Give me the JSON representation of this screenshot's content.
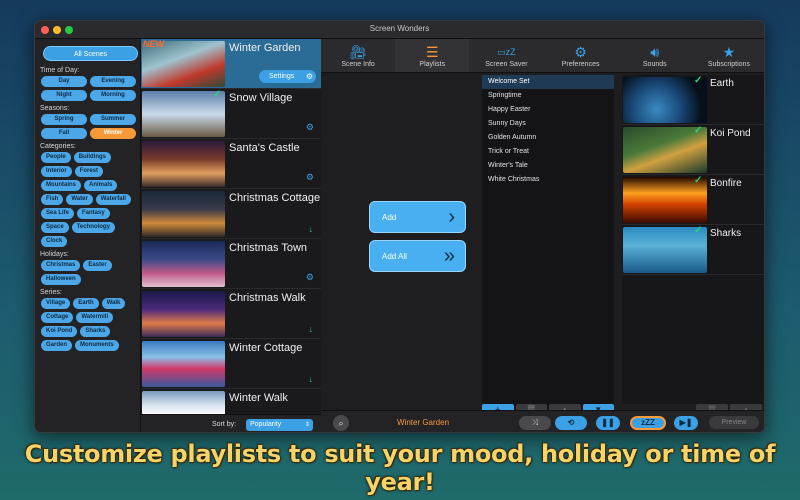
{
  "window": {
    "title": "Screen Wonders"
  },
  "filters": {
    "all_scenes": "All Scenes",
    "time_of_day": {
      "label": "Time of Day:",
      "items": [
        "Day",
        "Evening",
        "Night",
        "Morning"
      ]
    },
    "seasons": {
      "label": "Seasons:",
      "items": [
        "Spring",
        "Summer",
        "Fall",
        "Winter"
      ],
      "selected": "Winter"
    },
    "categories": {
      "label": "Categories:",
      "items": [
        "People",
        "Buildings",
        "Interior",
        "Forest",
        "Mountains",
        "Animals",
        "Fish",
        "Water",
        "Waterfall",
        "Sea Life",
        "Fantasy",
        "Space",
        "Technology",
        "Clock"
      ]
    },
    "holidays": {
      "label": "Holidays:",
      "items": [
        "Christmas",
        "Easter",
        "Halloween"
      ]
    },
    "series": {
      "label": "Series:",
      "items": [
        "Village",
        "Earth",
        "Walk",
        "Cottage",
        "Watermill",
        "Koi Pond",
        "Sharks",
        "Garden",
        "Monuments"
      ]
    }
  },
  "scenes": {
    "items": [
      {
        "name": "Winter Garden",
        "badge": "NEW",
        "settings": "Settings",
        "selected": true
      },
      {
        "name": "Snow Village",
        "checked": true
      },
      {
        "name": "Santa's Castle"
      },
      {
        "name": "Christmas Cottage",
        "download": true
      },
      {
        "name": "Christmas Town"
      },
      {
        "name": "Christmas Walk",
        "download": true
      },
      {
        "name": "Winter Cottage",
        "download": true
      },
      {
        "name": "Winter Walk"
      }
    ],
    "sort_label": "Sort by:",
    "sort_value": "Popularity"
  },
  "tabs": [
    {
      "label": "Scene Info",
      "icon": "film-icon"
    },
    {
      "label": "Playlists",
      "icon": "list-icon",
      "active": true
    },
    {
      "label": "Screen Saver",
      "icon": "zzz-monitor-icon"
    },
    {
      "label": "Preferences",
      "icon": "gears-icon"
    },
    {
      "label": "Sounds",
      "icon": "speaker-icon"
    },
    {
      "label": "Subscriptions",
      "icon": "star-icon"
    }
  ],
  "actions": {
    "add": "Add",
    "add_all": "Add All"
  },
  "playlists": {
    "items": [
      "Welcome Set",
      "Springtime",
      "Happy Easter",
      "Sunny Days",
      "Golden Autumn",
      "Trick or Treat",
      "Winter's Tale",
      "White Christmas"
    ],
    "selected": "Welcome Set"
  },
  "playlist_scenes": [
    {
      "name": "Earth"
    },
    {
      "name": "Koi Pond"
    },
    {
      "name": "Bonfire"
    },
    {
      "name": "Sharks"
    }
  ],
  "player": {
    "now_playing": "Winter Garden",
    "zzz": "zZZ",
    "preview": "Preview"
  },
  "caption": "Customize playlists to suit your mood, holiday or time of year!",
  "colors": {
    "accent": "#3ba0e4",
    "selected_pill": "#f5993a",
    "caption": "#f5d46a",
    "check": "#2fd07b"
  }
}
